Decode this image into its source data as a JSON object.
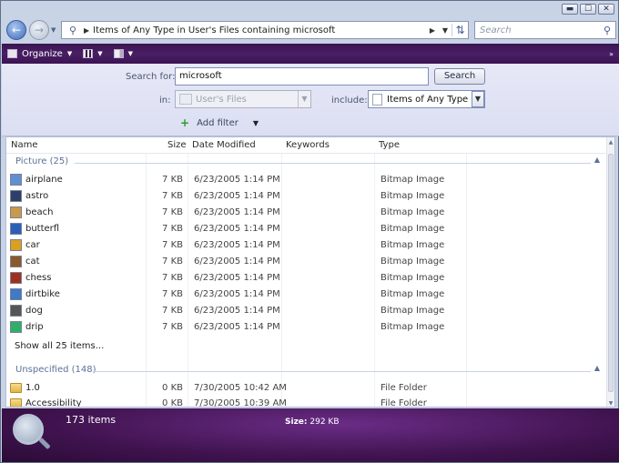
{
  "window": {
    "controls": {
      "minimize": "▬",
      "maximize": "☐",
      "close": "✕"
    }
  },
  "address_bar": {
    "path": "Items of Any Type in User's Files containing microsoft",
    "search_placeholder": "Search"
  },
  "toolbar": {
    "organize_label": "Organize"
  },
  "search_pane": {
    "search_for_label": "Search for:",
    "search_query": "microsoft",
    "search_button": "Search",
    "in_label": "in:",
    "in_value": "User's Files",
    "include_label": "include:",
    "include_value": "Items of Any Type",
    "add_filter_label": "Add filter"
  },
  "columns": {
    "name": "Name",
    "size": "Size",
    "date_modified": "Date Modified",
    "keywords": "Keywords",
    "type": "Type"
  },
  "groups": {
    "picture": "Picture (25)",
    "unspecified": "Unspecified (148)"
  },
  "pictures": [
    {
      "name": "airplane",
      "size": "7 KB",
      "date": "6/23/2005 1:14 PM",
      "type": "Bitmap Image",
      "thumb_color": "#5f8fd0"
    },
    {
      "name": "astro",
      "size": "7 KB",
      "date": "6/23/2005 1:14 PM",
      "type": "Bitmap Image",
      "thumb_color": "#2c3f6a"
    },
    {
      "name": "beach",
      "size": "7 KB",
      "date": "6/23/2005 1:14 PM",
      "type": "Bitmap Image",
      "thumb_color": "#c99a4a"
    },
    {
      "name": "butterfl",
      "size": "7 KB",
      "date": "6/23/2005 1:14 PM",
      "type": "Bitmap Image",
      "thumb_color": "#2a5fb8"
    },
    {
      "name": "car",
      "size": "7 KB",
      "date": "6/23/2005 1:14 PM",
      "type": "Bitmap Image",
      "thumb_color": "#d9a021"
    },
    {
      "name": "cat",
      "size": "7 KB",
      "date": "6/23/2005 1:14 PM",
      "type": "Bitmap Image",
      "thumb_color": "#8a5a2b"
    },
    {
      "name": "chess",
      "size": "7 KB",
      "date": "6/23/2005 1:14 PM",
      "type": "Bitmap Image",
      "thumb_color": "#a0301e"
    },
    {
      "name": "dirtbike",
      "size": "7 KB",
      "date": "6/23/2005 1:14 PM",
      "type": "Bitmap Image",
      "thumb_color": "#3d7ac8"
    },
    {
      "name": "dog",
      "size": "7 KB",
      "date": "6/23/2005 1:14 PM",
      "type": "Bitmap Image",
      "thumb_color": "#555555"
    },
    {
      "name": "drip",
      "size": "7 KB",
      "date": "6/23/2005 1:14 PM",
      "type": "Bitmap Image",
      "thumb_color": "#2fae6a"
    }
  ],
  "show_all_label": "Show all 25 items...",
  "unspecified": [
    {
      "name": "1.0",
      "size": "0 KB",
      "date": "7/30/2005 10:42 AM",
      "type": "File Folder"
    },
    {
      "name": "Accessibility",
      "size": "0 KB",
      "date": "7/30/2005 10:39 AM",
      "type": "File Folder"
    }
  ],
  "details": {
    "item_count": "173 items",
    "size_label": "Size:",
    "size_value": "292 KB"
  },
  "colors": {
    "toolbar": "#4a1e66",
    "details_pane": "#40134f",
    "group_header": "#5b7199"
  }
}
